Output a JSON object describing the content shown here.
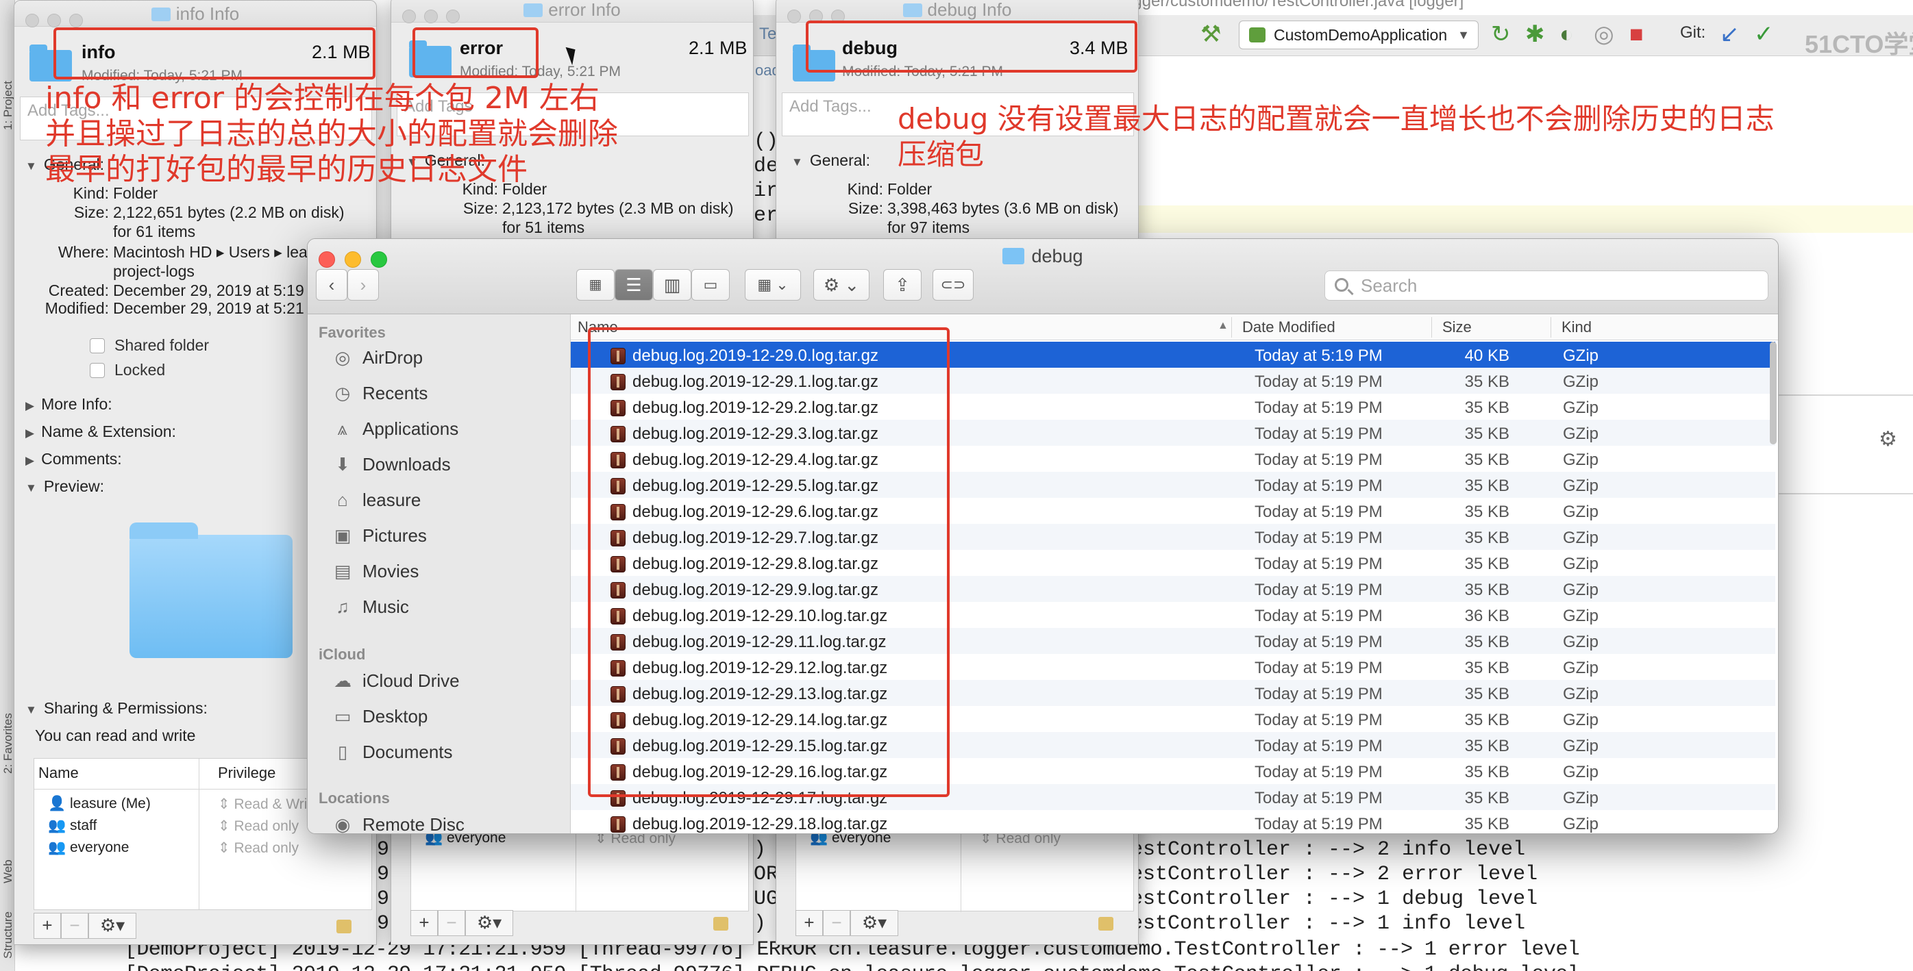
{
  "ide": {
    "path_text": "ogger/customdemo/TestController.java [logger]",
    "run_config": "CustomDemoApplication",
    "git_label": "Git:",
    "watermark": "51CTO学堂",
    "left_tabs": [
      "1: Project",
      "2: Favorites",
      "Web",
      "Structure"
    ],
    "code_fragments": [
      "()",
      "de",
      "ir",
      "er"
    ],
    "partial_tabs": [
      "Te",
      "oad",
      "de"
    ],
    "console_right": [
      "estController : --> 2 info level",
      "estController : --> 2 error level",
      "estController : --> 1 debug level",
      "estController : --> 1 info level"
    ],
    "console_left_digits": [
      "9",
      "9",
      "9",
      "9"
    ],
    "console_mid_marks": [
      ")",
      "OR",
      "UG",
      ")"
    ],
    "console_full": [
      "[DemoProject] 2019-12-29 17:21:21.959 [Thread-99776] ERROR  cn.leasure.logger.customdemo.TestController : --> 1 error level",
      "[DemoProject] 2019-12-29 17:21:21.959 [Thread-99776] DEBUG  cn.leasure.logger.customdemo.TestController : --> 1 debug level"
    ]
  },
  "info_window": {
    "title": "info Info",
    "name": "info",
    "size": "2.1 MB",
    "modified": "Modified: Today, 5:21 PM",
    "tags_placeholder": "Add Tags...",
    "general_label": "General:",
    "kind_label": "Kind:",
    "kind": "Folder",
    "size_label": "Size:",
    "size_detail": "2,122,651 bytes (2.2 MB on disk)",
    "size_items": "for 61 items",
    "where_label": "Where:",
    "where": "Macintosh HD ▸ Users ▸ lea",
    "where2": "project-logs",
    "created_label": "Created:",
    "created": "December 29, 2019 at 5:19",
    "modified_label": "Modified:",
    "modified_full": "December 29, 2019 at 5:21",
    "shared_folder": "Shared folder",
    "locked": "Locked",
    "more_info": "More Info:",
    "name_ext": "Name & Extension:",
    "comments": "Comments:",
    "preview": "Preview:",
    "sharing": "Sharing & Permissions:",
    "can_rw": "You can read and write",
    "col_name": "Name",
    "col_priv": "Privilege",
    "perms": [
      {
        "name": "leasure (Me)",
        "priv": "Read & Writ"
      },
      {
        "name": "staff",
        "priv": "Read only"
      },
      {
        "name": "everyone",
        "priv": "Read only"
      }
    ]
  },
  "error_window": {
    "title": "error Info",
    "name": "error",
    "size": "2.1 MB",
    "modified": "Modified: Today, 5:21 PM",
    "tags_placeholder": "Add Tags",
    "general_label": "General:",
    "kind_label": "Kind:",
    "kind": "Folder",
    "size_label": "Size:",
    "size_detail": "2,123,172 bytes (2.3 MB on disk)",
    "size_items": "for 51 items",
    "perm_name": "everyone",
    "perm_priv": "Read only"
  },
  "debug_window": {
    "title": "debug Info",
    "name": "debug",
    "size": "3.4 MB",
    "modified": "Modified: Today, 5:21 PM",
    "tags_placeholder": "Add Tags...",
    "general_label": "General:",
    "kind_label": "Kind:",
    "kind": "Folder",
    "size_label": "Size:",
    "size_detail": "3,398,463 bytes (3.6 MB on disk)",
    "size_items": "for 97 items",
    "perm_name": "everyone",
    "perm_priv": "Read only"
  },
  "annotations": {
    "left_line1": "info 和 error 的会控制在每个包 2M 左右",
    "left_line2": "并且操过了日志的总的大小的配置就会删除",
    "left_line3": "最早的打好包的最早的历史日志文件",
    "right_line1": "debug 没有设置最大日志的配置就会一直增长也不会删除历史的日志",
    "right_line2": "压缩包",
    "color": "#e0392b"
  },
  "finder": {
    "title": "debug",
    "search_placeholder": "Search",
    "sidebar": {
      "favorites_header": "Favorites",
      "favorites": [
        {
          "label": "AirDrop",
          "icon": "airdrop-icon"
        },
        {
          "label": "Recents",
          "icon": "clock-icon"
        },
        {
          "label": "Applications",
          "icon": "applications-icon"
        },
        {
          "label": "Downloads",
          "icon": "download-icon"
        },
        {
          "label": "leasure",
          "icon": "home-icon"
        },
        {
          "label": "Pictures",
          "icon": "camera-icon"
        },
        {
          "label": "Movies",
          "icon": "film-icon"
        },
        {
          "label": "Music",
          "icon": "music-icon"
        }
      ],
      "icloud_header": "iCloud",
      "icloud": [
        {
          "label": "iCloud Drive",
          "icon": "cloud-icon"
        },
        {
          "label": "Desktop",
          "icon": "desktop-icon"
        },
        {
          "label": "Documents",
          "icon": "document-icon"
        }
      ],
      "locations_header": "Locations",
      "locations": [
        {
          "label": "Remote Disc",
          "icon": "disc-icon"
        }
      ]
    },
    "columns": {
      "name": "Name",
      "date": "Date Modified",
      "size": "Size",
      "kind": "Kind"
    },
    "files": [
      {
        "name": "debug.log.2019-12-29.0.log.tar.gz",
        "date": "Today at 5:19 PM",
        "size": "40 KB",
        "kind": "GZip"
      },
      {
        "name": "debug.log.2019-12-29.1.log.tar.gz",
        "date": "Today at 5:19 PM",
        "size": "35 KB",
        "kind": "GZip"
      },
      {
        "name": "debug.log.2019-12-29.2.log.tar.gz",
        "date": "Today at 5:19 PM",
        "size": "35 KB",
        "kind": "GZip"
      },
      {
        "name": "debug.log.2019-12-29.3.log.tar.gz",
        "date": "Today at 5:19 PM",
        "size": "35 KB",
        "kind": "GZip"
      },
      {
        "name": "debug.log.2019-12-29.4.log.tar.gz",
        "date": "Today at 5:19 PM",
        "size": "35 KB",
        "kind": "GZip"
      },
      {
        "name": "debug.log.2019-12-29.5.log.tar.gz",
        "date": "Today at 5:19 PM",
        "size": "35 KB",
        "kind": "GZip"
      },
      {
        "name": "debug.log.2019-12-29.6.log.tar.gz",
        "date": "Today at 5:19 PM",
        "size": "35 KB",
        "kind": "GZip"
      },
      {
        "name": "debug.log.2019-12-29.7.log.tar.gz",
        "date": "Today at 5:19 PM",
        "size": "35 KB",
        "kind": "GZip"
      },
      {
        "name": "debug.log.2019-12-29.8.log.tar.gz",
        "date": "Today at 5:19 PM",
        "size": "35 KB",
        "kind": "GZip"
      },
      {
        "name": "debug.log.2019-12-29.9.log.tar.gz",
        "date": "Today at 5:19 PM",
        "size": "35 KB",
        "kind": "GZip"
      },
      {
        "name": "debug.log.2019-12-29.10.log.tar.gz",
        "date": "Today at 5:19 PM",
        "size": "36 KB",
        "kind": "GZip"
      },
      {
        "name": "debug.log.2019-12-29.11.log.tar.gz",
        "date": "Today at 5:19 PM",
        "size": "35 KB",
        "kind": "GZip"
      },
      {
        "name": "debug.log.2019-12-29.12.log.tar.gz",
        "date": "Today at 5:19 PM",
        "size": "35 KB",
        "kind": "GZip"
      },
      {
        "name": "debug.log.2019-12-29.13.log.tar.gz",
        "date": "Today at 5:19 PM",
        "size": "35 KB",
        "kind": "GZip"
      },
      {
        "name": "debug.log.2019-12-29.14.log.tar.gz",
        "date": "Today at 5:19 PM",
        "size": "35 KB",
        "kind": "GZip"
      },
      {
        "name": "debug.log.2019-12-29.15.log.tar.gz",
        "date": "Today at 5:19 PM",
        "size": "35 KB",
        "kind": "GZip"
      },
      {
        "name": "debug.log.2019-12-29.16.log.tar.gz",
        "date": "Today at 5:19 PM",
        "size": "35 KB",
        "kind": "GZip"
      },
      {
        "name": "debug.log.2019-12-29.17.log.tar.gz",
        "date": "Today at 5:19 PM",
        "size": "35 KB",
        "kind": "GZip"
      },
      {
        "name": "debug.log.2019-12-29.18.log.tar.gz",
        "date": "Today at 5:19 PM",
        "size": "35 KB",
        "kind": "GZip"
      }
    ]
  }
}
